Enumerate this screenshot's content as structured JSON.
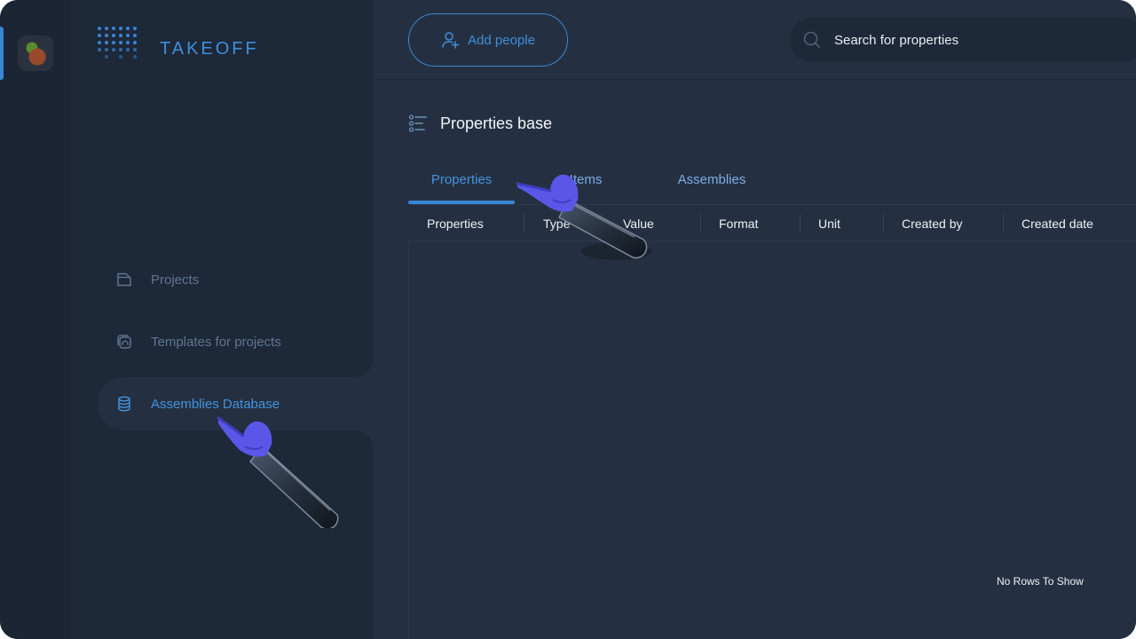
{
  "brand": {
    "name": "TAKEOFF"
  },
  "sidebar": {
    "items": [
      {
        "label": "Projects",
        "icon": "folder-icon"
      },
      {
        "label": "Templates for projects",
        "icon": "templates-icon"
      },
      {
        "label": "Assemblies Database",
        "icon": "database-icon",
        "active": true
      }
    ]
  },
  "header": {
    "add_people_label": "Add people",
    "search_placeholder": "Search for properties"
  },
  "main": {
    "title": "Properties base",
    "tabs": [
      {
        "label": "Properties",
        "active": true
      },
      {
        "label": "Items"
      },
      {
        "label": "Assemblies"
      }
    ],
    "columns": [
      "Properties",
      "Type",
      "Value",
      "Format",
      "Unit",
      "Created by",
      "Created date"
    ],
    "rows": [],
    "empty_message": "No Rows To Show"
  },
  "colors": {
    "accent": "#3a86d6",
    "background": "#243041",
    "sidebar": "#1d2838"
  }
}
